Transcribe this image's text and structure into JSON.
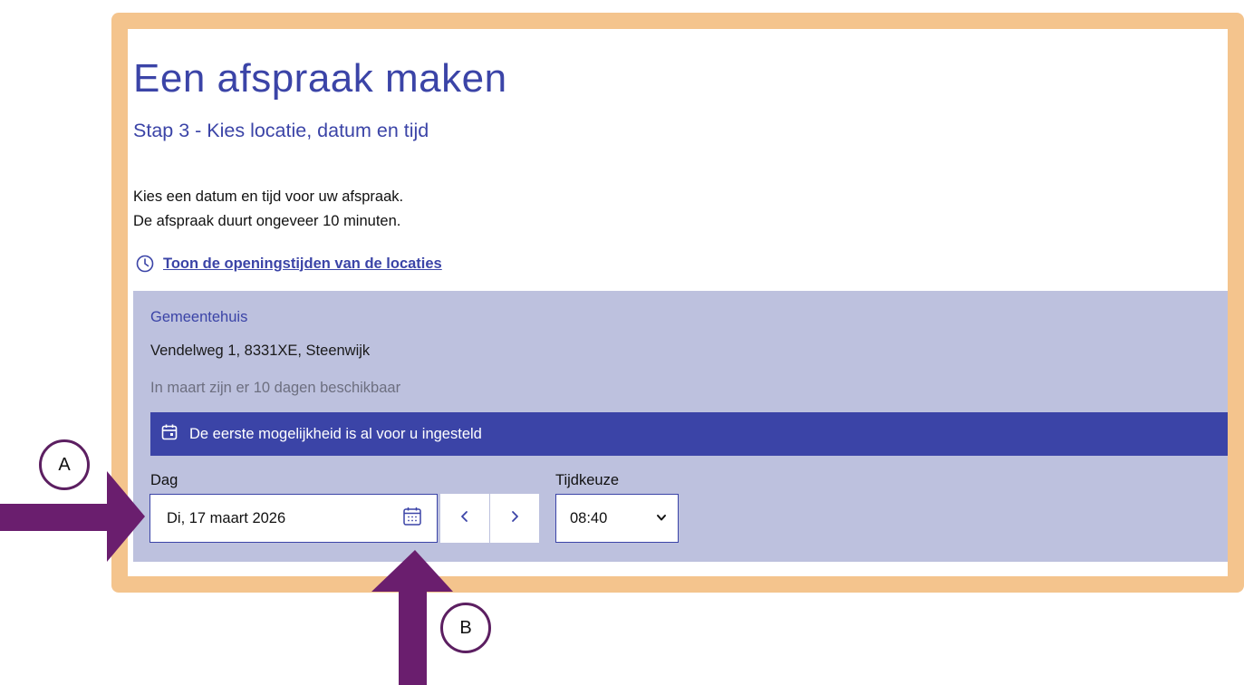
{
  "heading": {
    "title": "Een afspraak maken",
    "step": "Stap 3 - Kies locatie, datum en tijd"
  },
  "intro": {
    "line1": "Kies een datum en tijd voor uw afspraak.",
    "line2": "De afspraak duurt ongeveer 10 minuten."
  },
  "hours_link": {
    "icon": "clock-icon",
    "label": "Toon de openingstijden van de locaties"
  },
  "location": {
    "name": "Gemeentehuis",
    "address": "Vendelweg 1, 8331XE, Steenwijk",
    "availability": "In maart zijn er 10 dagen beschikbaar"
  },
  "notice": {
    "icon": "calendar-icon",
    "text": "De eerste mogelijkheid is al voor u ingesteld"
  },
  "form": {
    "day_label": "Dag",
    "day_value": "Di, 17 maart 2026",
    "time_label": "Tijdkeuze",
    "time_value": "08:40",
    "prev_icon": "chevron-left-icon",
    "next_icon": "chevron-right-icon"
  },
  "annotations": {
    "marker_a": "A",
    "marker_b": "B"
  },
  "colors": {
    "accent": "#3b44a7",
    "frame": "#f4c48d",
    "location_bg": "#bdc1de",
    "arrow": "#6a1e6e"
  }
}
